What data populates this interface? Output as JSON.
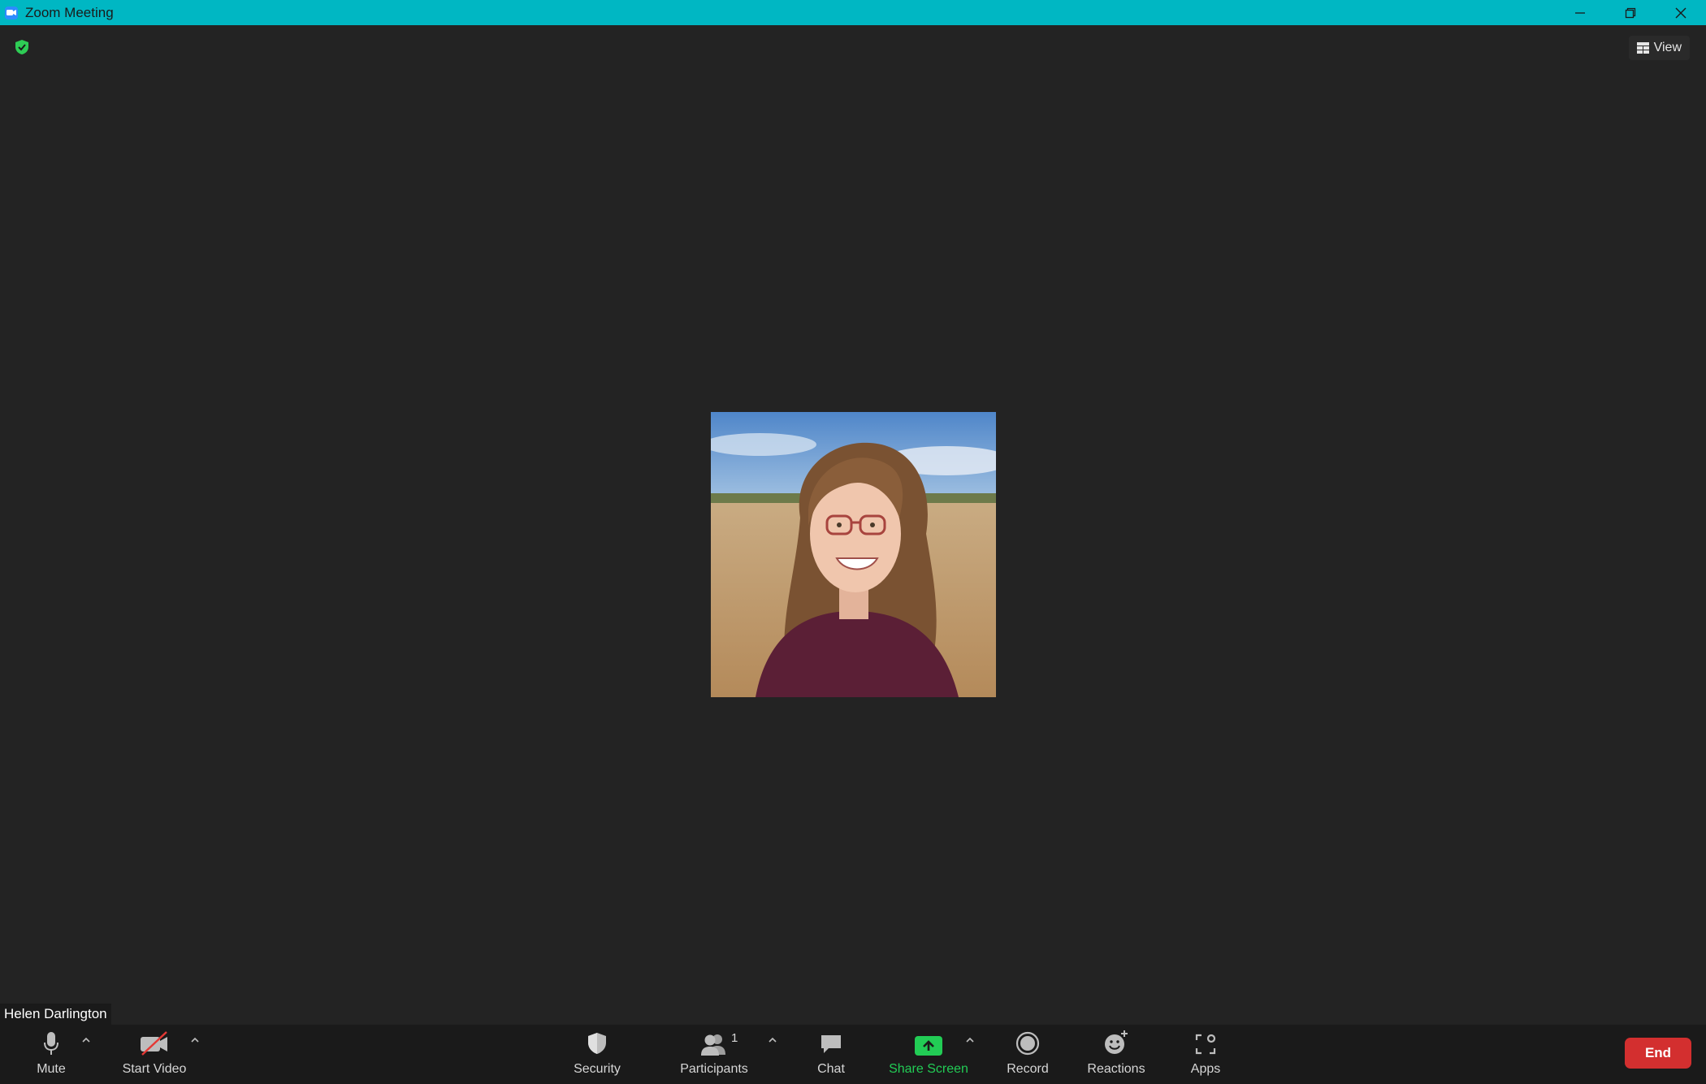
{
  "window": {
    "title": "Zoom Meeting",
    "colors": {
      "titlebar": "#00b7c3",
      "background": "#232323",
      "toolbar": "#1a1a1a",
      "accent_green": "#22cc55",
      "end_red": "#d32f2f"
    }
  },
  "top_bar": {
    "security_badge_icon": "shield-check-icon",
    "view_label": "View",
    "view_icon": "grid-icon"
  },
  "participant": {
    "name": "Helen Darlington"
  },
  "toolbar": {
    "mute_label": "Mute",
    "start_video_label": "Start Video",
    "security_label": "Security",
    "participants_label": "Participants",
    "participants_count": "1",
    "chat_label": "Chat",
    "share_screen_label": "Share Screen",
    "record_label": "Record",
    "reactions_label": "Reactions",
    "apps_label": "Apps",
    "end_label": "End"
  }
}
